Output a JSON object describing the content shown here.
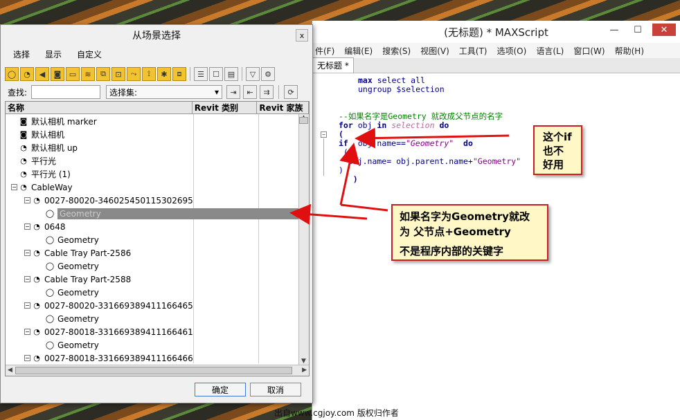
{
  "dialog": {
    "title": "从场景选择",
    "close": "x",
    "menu": [
      "选择",
      "显示",
      "自定义"
    ],
    "find_label": "查找:",
    "find_value": "",
    "selset_label": "选择集:",
    "columns": [
      "名称",
      "Revit 类别",
      "Revit 家族"
    ],
    "rows": [
      {
        "label": "默认相机 marker",
        "icon": "camera-icon",
        "level": 0
      },
      {
        "label": "默认相机",
        "icon": "camera-icon",
        "level": 0
      },
      {
        "label": "默认相机 up",
        "icon": "light-icon",
        "level": 0
      },
      {
        "label": "平行光",
        "icon": "light-icon",
        "level": 0
      },
      {
        "label": "平行光 (1)",
        "icon": "light-icon",
        "level": 0
      },
      {
        "label": "CableWay",
        "icon": "light-icon",
        "level": 0,
        "expander": "-"
      },
      {
        "label": "0027-80020-346025450115302695",
        "icon": "light-icon",
        "level": 1,
        "expander": "-"
      },
      {
        "label": "Geometry",
        "icon": "sphere-icon",
        "level": 2,
        "highlight": true
      },
      {
        "label": "0648",
        "icon": "light-icon",
        "level": 1,
        "expander": "-"
      },
      {
        "label": "Geometry",
        "icon": "sphere-icon",
        "level": 2
      },
      {
        "label": "Cable Tray Part-2586",
        "icon": "light-icon",
        "level": 1,
        "expander": "-"
      },
      {
        "label": "Geometry",
        "icon": "sphere-icon",
        "level": 2
      },
      {
        "label": "Cable Tray Part-2588",
        "icon": "light-icon",
        "level": 1,
        "expander": "-"
      },
      {
        "label": "Geometry",
        "icon": "sphere-icon",
        "level": 2
      },
      {
        "label": "0027-80020-331669389411166465",
        "icon": "light-icon",
        "level": 1,
        "expander": "-"
      },
      {
        "label": "Geometry",
        "icon": "sphere-icon",
        "level": 2
      },
      {
        "label": "0027-80018-331669389411166461",
        "icon": "light-icon",
        "level": 1,
        "expander": "-"
      },
      {
        "label": "Geometry",
        "icon": "sphere-icon",
        "level": 2
      },
      {
        "label": "0027-80018-331669389411166466",
        "icon": "light-icon",
        "level": 1,
        "expander": "-"
      }
    ],
    "ok": "确定",
    "cancel": "取消"
  },
  "maxscript": {
    "title": "(无标题) * MAXScript",
    "menu": [
      "件(F)",
      "编辑(E)",
      "搜索(S)",
      "视图(V)",
      "工具(T)",
      "选项(O)",
      "语言(L)",
      "窗口(W)",
      "帮助(H)"
    ],
    "tab": "无标题 *",
    "code": {
      "l1_kw": "max",
      "l1_rest": " select all",
      "l2_kw": "ungroup",
      "l2_rest": " $selection",
      "comment": "--如果名字是Geometry 就改成父节点的名字",
      "for_kw": "for",
      "for_obj": " obj ",
      "in_kw": "in",
      "selection": " selection ",
      "do_kw": "do",
      "paren_open": "(",
      "if_kw": "if",
      "if_cond": "  obj.name==",
      "if_str": "\"Geometry\"",
      "do2": "  do",
      "paren2": " (",
      "assign": "  obj.name= obj.parent.name+",
      "assign_str": "\"Geometry\"",
      "close1": ")",
      "close2": "   )"
    }
  },
  "callouts": {
    "c1": [
      "这个if",
      "也不",
      "好用"
    ],
    "c2_l1": "如果名字为Geometry就改",
    "c2_l2": "为 父节点+Geometry",
    "c2_l3": "不是程序内部的关键字"
  },
  "watermark": "出自www.cgjoy.com 版权归作者",
  "colors": {
    "arrow": "#e01010",
    "callout_bg": "#fff8c6",
    "callout_border": "#c82020"
  }
}
